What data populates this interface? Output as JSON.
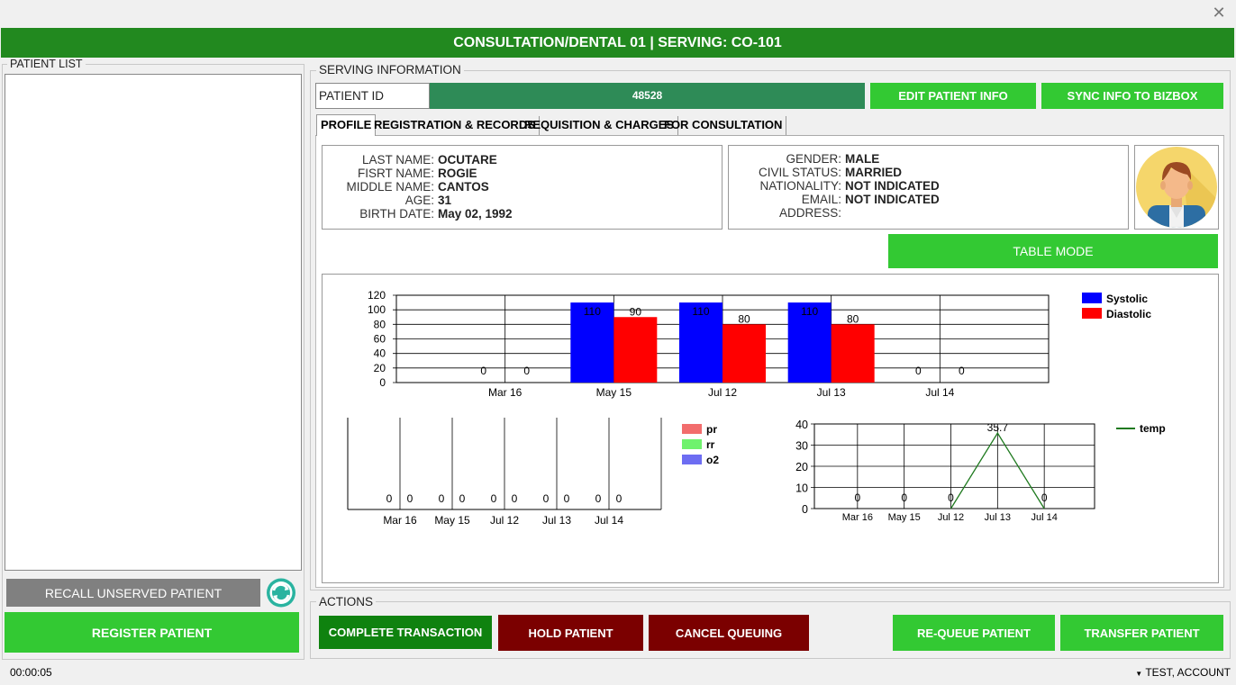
{
  "header": {
    "title": "CONSULTATION/DENTAL 01 | SERVING: CO-101"
  },
  "patient_list": {
    "title": "PATIENT LIST",
    "recall_label": "RECALL UNSERVED PATIENT",
    "register_label": "REGISTER PATIENT"
  },
  "serving": {
    "title": "SERVING INFORMATION",
    "patient_id_label": "PATIENT ID",
    "patient_id_value": "48528",
    "edit_label": "EDIT PATIENT INFO",
    "sync_label": "SYNC INFO TO BIZBOX"
  },
  "tabs": [
    "PROFILE",
    "REGISTRATION & RECORDS",
    "REQUISITION & CHARGES",
    "FOR CONSULTATION"
  ],
  "profile": {
    "last_name_label": "LAST NAME:",
    "last_name": "OCUTARE",
    "first_name_label": "FISRT NAME:",
    "first_name": "ROGIE",
    "middle_name_label": "MIDDLE NAME:",
    "middle_name": "CANTOS",
    "age_label": "AGE:",
    "age": "31",
    "birth_date_label": "BIRTH DATE:",
    "birth_date": "May 02, 1992",
    "gender_label": "GENDER:",
    "gender": "MALE",
    "civil_status_label": "CIVIL STATUS:",
    "civil_status": "MARRIED",
    "nationality_label": "NATIONALITY:",
    "nationality": "NOT INDICATED",
    "email_label": "EMAIL:",
    "email": "NOT INDICATED",
    "address_label": "ADDRESS:",
    "address": ""
  },
  "table_mode_label": "TABLE MODE",
  "chart_data": [
    {
      "type": "bar",
      "categories": [
        "Mar 16",
        "May 15",
        "Jul 12",
        "Jul 13",
        "Jul 14"
      ],
      "series": [
        {
          "name": "Systolic",
          "color": "#0000ff",
          "values": [
            0,
            110,
            110,
            110,
            0
          ]
        },
        {
          "name": "Diastolic",
          "color": "#ff0000",
          "values": [
            0,
            90,
            80,
            80,
            0
          ]
        }
      ],
      "yticks": [
        "0",
        "20",
        "40",
        "60",
        "80",
        "100",
        "120"
      ],
      "ylim": [
        0,
        120
      ],
      "legend": "top-right"
    },
    {
      "type": "bar",
      "categories": [
        "Mar 16",
        "May 15",
        "Jul 12",
        "Jul 13",
        "Jul 14"
      ],
      "series": [
        {
          "name": "pr",
          "color": "#f26d6d",
          "values": [
            0,
            0,
            0,
            0,
            0
          ]
        },
        {
          "name": "rr",
          "color": "#6ff26d",
          "values": [
            0,
            0,
            0,
            0,
            0
          ]
        },
        {
          "name": "o2",
          "color": "#6d6df2",
          "values": [
            0,
            0,
            0,
            0,
            0
          ]
        }
      ],
      "legend": "top-right"
    },
    {
      "type": "line",
      "categories": [
        "Mar 16",
        "May 15",
        "Jul 12",
        "Jul 13",
        "Jul 14"
      ],
      "series": [
        {
          "name": "temp",
          "color": "#1f7a1f",
          "values": [
            0,
            0,
            0,
            35.7,
            0
          ]
        }
      ],
      "yticks": [
        "0",
        "10",
        "20",
        "30",
        "40"
      ],
      "ylim": [
        0,
        40
      ],
      "legend": "top-right"
    }
  ],
  "actions": {
    "title": "ACTIONS",
    "complete": "COMPLETE TRANSACTION",
    "hold": "HOLD PATIENT",
    "cancel": "CANCEL QUEUING",
    "requeue": "RE-QUEUE PATIENT",
    "transfer": "TRANSFER PATIENT"
  },
  "status": {
    "timer": "00:00:05",
    "account": "TEST, ACCOUNT"
  }
}
